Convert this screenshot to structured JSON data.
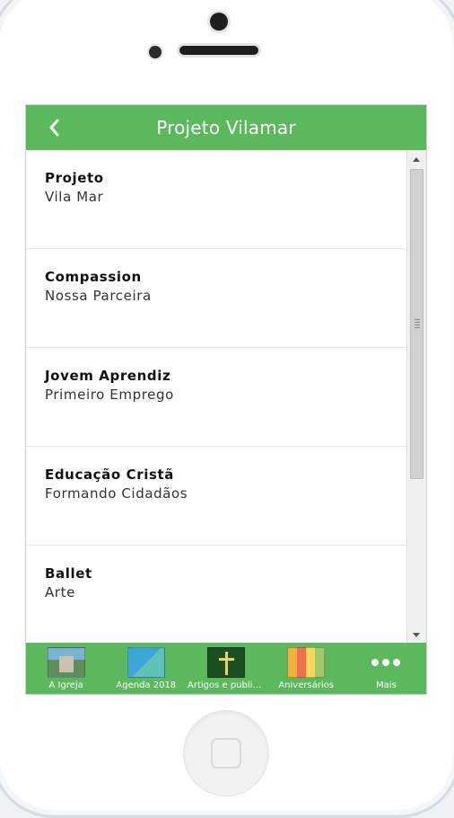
{
  "header": {
    "title": "Projeto Vilamar"
  },
  "list": {
    "items": [
      {
        "title": "Projeto",
        "subtitle": "Vila Mar"
      },
      {
        "title": "Compassion",
        "subtitle": "Nossa Parceira"
      },
      {
        "title": "Jovem Aprendiz",
        "subtitle": "Primeiro Emprego"
      },
      {
        "title": "Educação Cristã",
        "subtitle": "Formando Cidadãos"
      },
      {
        "title": "Ballet",
        "subtitle": "Arte"
      }
    ]
  },
  "tabbar": {
    "tabs": [
      {
        "label": "A Igreja",
        "icon": "church-image-icon"
      },
      {
        "label": "Agenda 2018",
        "icon": "agenda-image-icon"
      },
      {
        "label": "Artigos e publicações",
        "icon": "cross-image-icon"
      },
      {
        "label": "Aniversários",
        "icon": "birthday-image-icon"
      },
      {
        "label": "Mais",
        "icon": "more-dots-icon"
      }
    ]
  },
  "colors": {
    "accent": "#5cb85c",
    "header_text": "#ffffff"
  }
}
